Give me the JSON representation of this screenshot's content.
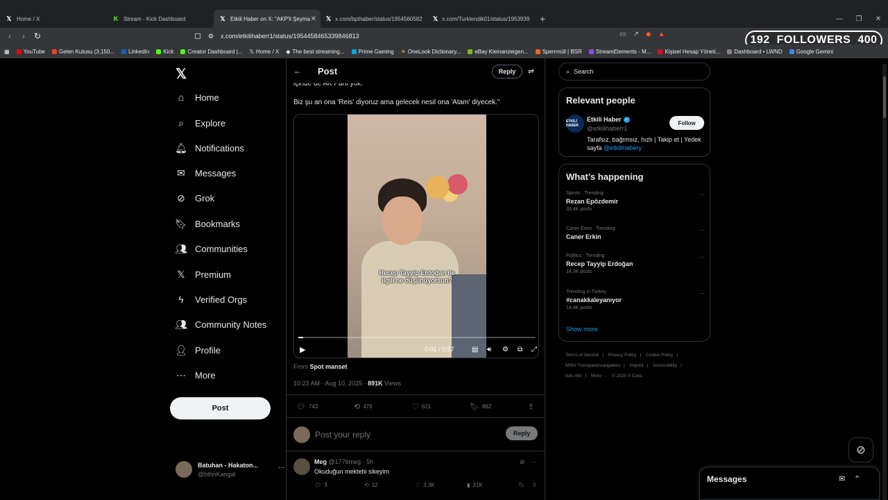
{
  "browser": {
    "tabs": [
      {
        "title": "Home / X",
        "icon": "x-logo-icon"
      },
      {
        "title": "Stream - Kick Dashboard",
        "icon": "kick-icon"
      },
      {
        "title": "Etkili Haber on X: \"AKP'li Şeyma",
        "icon": "x-logo-icon"
      },
      {
        "title": "x.com/bpthaber/status/1954560582",
        "icon": "x-logo-icon"
      },
      {
        "title": "x.com/Turklendik01/status/1953939",
        "icon": "x-logo-icon"
      }
    ],
    "url": "x.com/etkilihaberr1/status/1954458465339846813",
    "bookmarks": [
      "YouTube",
      "Gelen Kutusu (3.150...",
      "LinkedIn",
      "Kick",
      "Creator Dashboard |...",
      "Home / X",
      "The best streaming...",
      "Prime Gaming",
      "OneLook Dictionary...",
      "eBay Kleinanzeigen...",
      "Sperrmüll | BSR",
      "StreamElements - M...",
      "Kişisel Hesap Yöneti...",
      "Dashboard • LWND",
      "Google Gemini"
    ]
  },
  "overlay": {
    "followers_current": "192",
    "followers_label": "FOLLOWERS",
    "followers_goal": "400"
  },
  "nav": {
    "items": [
      {
        "label": "Home",
        "icon": "home-icon"
      },
      {
        "label": "Explore",
        "icon": "search-icon"
      },
      {
        "label": "Notifications",
        "icon": "bell-icon"
      },
      {
        "label": "Messages",
        "icon": "mail-icon"
      },
      {
        "label": "Grok",
        "icon": "grok-icon"
      },
      {
        "label": "Bookmarks",
        "icon": "bookmark-icon"
      },
      {
        "label": "Communities",
        "icon": "communities-icon"
      },
      {
        "label": "Premium",
        "icon": "x-logo-icon"
      },
      {
        "label": "Verified Orgs",
        "icon": "lightning-icon"
      },
      {
        "label": "Community Notes",
        "icon": "community-notes-icon"
      },
      {
        "label": "Profile",
        "icon": "person-icon"
      },
      {
        "label": "More",
        "icon": "more-circle-icon"
      }
    ],
    "post_button": "Post",
    "account": {
      "name": "Batuhan - Hakaton...",
      "handle": "@bthnKangal"
    }
  },
  "post": {
    "header_title": "Post",
    "reply_label": "Reply",
    "cut_text": "içinde de AK Parti yok.",
    "text": "Biz şu an ona 'Reis' diyoruz ama gelecek nesil ona 'Atam' diyecek.\"",
    "video": {
      "subtitle_line1": "Recep Tayyip Erdoğan ile",
      "subtitle_line2": "ilgili ne düşünüyorsun?",
      "time": "0:01 / 0:57",
      "progress": 0.02
    },
    "from_label": "From",
    "from_source": "Spot manset",
    "timestamp": "10:23 AM · Aug 10, 2025 ·",
    "views_count": "891K",
    "views_label": "Views",
    "stats": {
      "replies": "743",
      "reposts": "478",
      "likes": "621",
      "bookmarks": "882"
    },
    "reply_placeholder": "Post your reply",
    "reply_button": "Reply"
  },
  "reply": {
    "name": "Meg",
    "handle_time": "@1776meg · 5h",
    "text": "Okuduğun mektebi sikeyim",
    "stats": {
      "replies": "3",
      "reposts": "12",
      "likes": "3.3K",
      "views": "31K"
    }
  },
  "sidebar": {
    "search_placeholder": "Search",
    "relevant_title": "Relevant people",
    "person": {
      "name": "Etkili Haber",
      "handle": "@etkilihaberr1",
      "bio": "Tarafsız, bağımsız, hızlı | Takip et | Yedek sayfa",
      "bio_link": "@etkilihabery",
      "avatar_text": "ETKİLİ HABER",
      "follow": "Follow"
    },
    "happening_title": "What’s happening",
    "trends": [
      {
        "context": "Sports · Trending",
        "name": "Rezan Epözdemir",
        "posts": "33.4K posts"
      },
      {
        "context": "Caner Erkin · Trending",
        "name": "Caner Erkin",
        "posts": ""
      },
      {
        "context": "Politics · Trending",
        "name": "Recep Tayyip Erdoğan",
        "posts": "14.9K posts"
      },
      {
        "context": "Trending in Turkey",
        "name": "#canakkaleyanıyor",
        "posts": "14.4K posts"
      }
    ],
    "show_more": "Show more",
    "footer": [
      "Terms of Service",
      "|",
      "Privacy Policy",
      "|",
      "Cookie Policy",
      "|",
      "MStV Transparenzangaben",
      "|",
      "Imprint",
      "|",
      "Accessibility",
      "|",
      "Ads info",
      "|",
      "More ···",
      "© 2025 X Corp."
    ]
  },
  "messages_dock": {
    "title": "Messages"
  }
}
